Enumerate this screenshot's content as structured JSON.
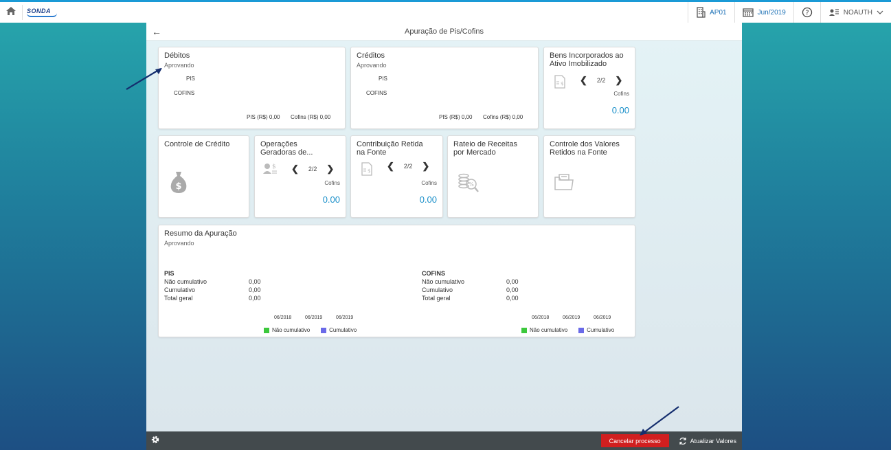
{
  "topbar": {
    "logo": "SONDA",
    "company": "AP01",
    "period": "Jun/2019",
    "user": "NOAUTH"
  },
  "page": {
    "title": "Apuração de Pis/Cofins"
  },
  "debitos": {
    "title": "Débitos",
    "status": "Aprovando",
    "pis": "PIS",
    "cofins": "COFINS",
    "pis_total": "PIS (R$) 0,00",
    "cofins_total": "Cofins (R$) 0,00"
  },
  "creditos": {
    "title": "Créditos",
    "status": "Aprovando",
    "pis": "PIS",
    "cofins": "COFINS",
    "pis_total": "PIS (R$) 0,00",
    "cofins_total": "Cofins (R$) 0,00"
  },
  "bens": {
    "title_line1": "Bens Incorporados ao",
    "title_line2": "Ativo Imobilizado",
    "page": "2/2",
    "label": "Cofins",
    "value": "0.00"
  },
  "controle_credito": {
    "title": "Controle de Crédito"
  },
  "operacoes": {
    "title_line1": "Operações",
    "title_line2": "Geradoras de...",
    "page": "2/2",
    "label": "Cofins",
    "value": "0.00"
  },
  "contribuicao": {
    "title_line1": "Contribuição Retida",
    "title_line2": "na Fonte",
    "page": "2/2",
    "label": "Cofins",
    "value": "0.00"
  },
  "rateio": {
    "title_line1": "Rateio de Receitas",
    "title_line2": "por Mercado"
  },
  "controle_valores": {
    "title_line1": "Controle dos Valores",
    "title_line2": "Retidos na Fonte"
  },
  "resumo": {
    "title": "Resumo da Apuração",
    "status": "Aprovando",
    "pis": {
      "heading": "PIS",
      "rows": [
        {
          "label": "Não cumulativo",
          "value": "0,00"
        },
        {
          "label": "Cumulativo",
          "value": "0,00"
        },
        {
          "label": "Total geral",
          "value": "0,00"
        }
      ],
      "dates": [
        "06/2018",
        "06/2019",
        "06/2019"
      ]
    },
    "cofins": {
      "heading": "COFINS",
      "rows": [
        {
          "label": "Não cumulativo",
          "value": "0,00"
        },
        {
          "label": "Cumulativo",
          "value": "0,00"
        },
        {
          "label": "Total geral",
          "value": "0,00"
        }
      ],
      "dates": [
        "06/2018",
        "06/2019",
        "06/2019"
      ]
    },
    "legend": [
      {
        "label": "Não cumulativo",
        "color": "#3cc83c"
      },
      {
        "label": "Cumulativo",
        "color": "#6a6ae8"
      }
    ]
  },
  "bottombar": {
    "cancel_label": "Cancelar processo",
    "refresh_label": "Atualizar Valores"
  }
}
